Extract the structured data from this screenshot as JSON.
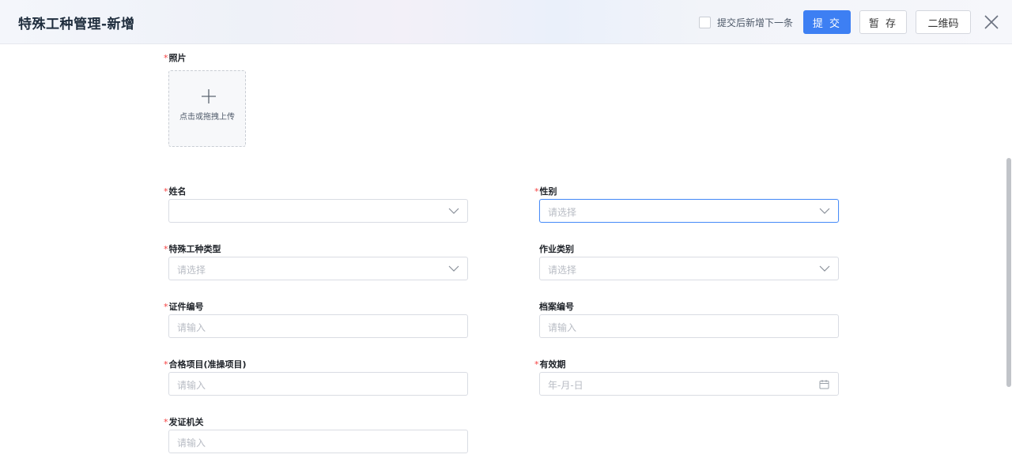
{
  "header": {
    "title": "特殊工种管理-新增",
    "continue_label": "提交后新增下一条",
    "submit_label": "提 交",
    "save_label": "暂 存",
    "qrcode_label": "二维码"
  },
  "photo": {
    "label": "照片",
    "upload_text": "点击或拖拽上传"
  },
  "fields": {
    "name": {
      "label": "姓名",
      "value": ""
    },
    "gender": {
      "label": "性别",
      "placeholder": "请选择"
    },
    "work_type": {
      "label": "特殊工种类型",
      "placeholder": "请选择"
    },
    "job_category": {
      "label": "作业类别",
      "placeholder": "请选择"
    },
    "cert_no": {
      "label": "证件编号",
      "placeholder": "请输入"
    },
    "archive_no": {
      "label": "档案编号",
      "placeholder": "请输入"
    },
    "qualified_item": {
      "label": "合格项目(准操项目)",
      "placeholder": "请输入"
    },
    "validity": {
      "label": "有效期",
      "placeholder": "年-月-日"
    },
    "issuer": {
      "label": "发证机关",
      "placeholder": "请输入"
    }
  },
  "required_mark": "*",
  "colors": {
    "primary": "#3d7ff3",
    "required": "#f53f3f",
    "focus_border": "#4a8df8"
  }
}
